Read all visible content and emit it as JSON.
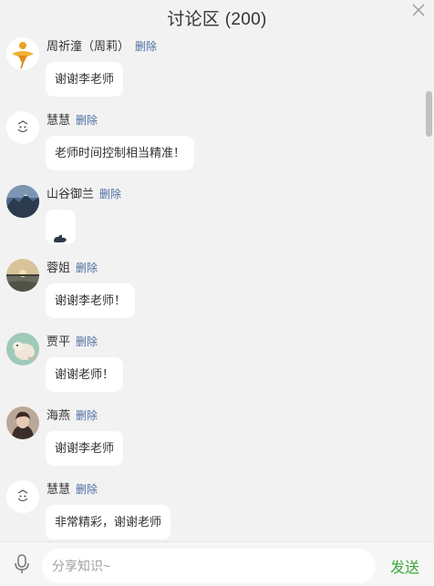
{
  "header": {
    "title": "讨论区 (200)"
  },
  "colors": {
    "background": "#f2f2f2",
    "bubble": "#ffffff",
    "delete_link": "#4f6ea3",
    "send_button": "#3aa83a"
  },
  "messages": [
    {
      "name": "周祈潼（周莉）",
      "delete_label": "删除",
      "text": "谢谢李老师",
      "avatar": "dancer-avatar"
    },
    {
      "name": "慧慧",
      "delete_label": "删除",
      "text": "老师时间控制相当精准！",
      "avatar": "doodle-avatar"
    },
    {
      "name": "山谷御兰",
      "delete_label": "删除",
      "text": "",
      "content_icon": "flexed-biceps-emoji",
      "avatar": "mountain-avatar"
    },
    {
      "name": "蓉姐",
      "delete_label": "删除",
      "text": "谢谢李老师！",
      "avatar": "sunset-lake-avatar"
    },
    {
      "name": "贾平",
      "delete_label": "删除",
      "text": "谢谢老师！",
      "avatar": "animal-avatar"
    },
    {
      "name": "海燕",
      "delete_label": "删除",
      "text": "谢谢李老师",
      "avatar": "portrait-avatar"
    },
    {
      "name": "慧慧",
      "delete_label": "删除",
      "text": "非常精彩，谢谢老师",
      "avatar": "doodle-avatar"
    }
  ],
  "composer": {
    "placeholder": "分享知识~",
    "send_label": "发送",
    "mic_icon": "microphone-icon"
  }
}
